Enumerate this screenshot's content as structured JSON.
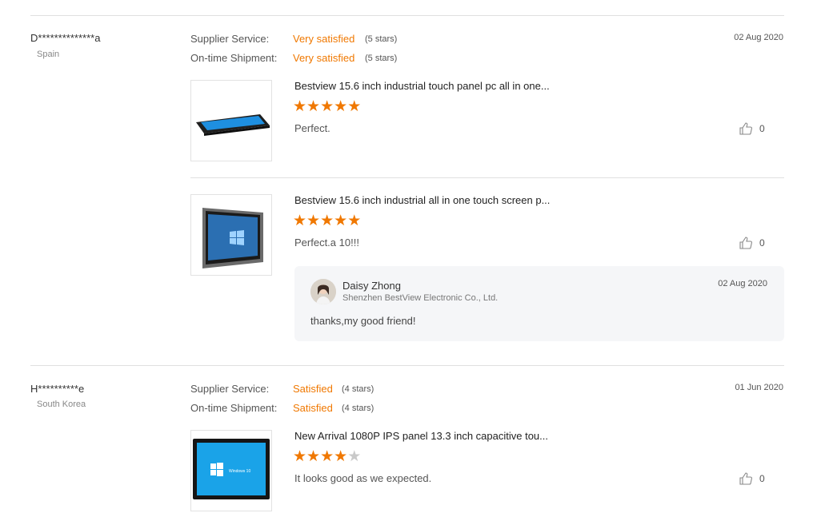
{
  "reviews": [
    {
      "buyer": "D**************a",
      "country": "Spain",
      "date": "02 Aug 2020",
      "supplier_service_label": "Supplier Service:",
      "supplier_service_rating": "Very satisfied",
      "supplier_service_stars": "(5 stars)",
      "shipment_label": "On-time Shipment:",
      "shipment_rating": "Very satisfied",
      "shipment_stars": "(5 stars)",
      "products": [
        {
          "title": "Bestview 15.6 inch industrial touch panel pc all in one...",
          "rating": 5,
          "comment": "Perfect.",
          "likes": "0",
          "image": "wide-panel-pc"
        },
        {
          "title": "Bestview 15.6 inch industrial all in one touch screen p...",
          "rating": 5,
          "comment": "Perfect.a 10!!!",
          "likes": "0",
          "image": "windows-touch-screen",
          "reply": {
            "name": "Daisy Zhong",
            "company": "Shenzhen BestView Electronic Co., Ltd.",
            "date": "02 Aug 2020",
            "text": "thanks,my good friend!"
          }
        }
      ]
    },
    {
      "buyer": "H**********e",
      "country": "South Korea",
      "date": "01 Jun 2020",
      "supplier_service_label": "Supplier Service:",
      "supplier_service_rating": "Satisfied",
      "supplier_service_stars": "(4 stars)",
      "shipment_label": "On-time Shipment:",
      "shipment_rating": "Satisfied",
      "shipment_stars": "(4 stars)",
      "products": [
        {
          "title": "New Arrival 1080P IPS panel 13.3 inch capacitive tou...",
          "rating": 4,
          "comment": "It looks good as we expected.",
          "likes": "0",
          "image": "windows-10-tablet",
          "image_text": "Windows 10"
        }
      ]
    }
  ],
  "colors": {
    "accent": "#f07800",
    "star_off": "#c9c9c9",
    "divider": "#e0e0e0",
    "reply_bg": "#f5f6f8"
  },
  "icons": {
    "like": "thumbs-up-icon",
    "star": "star-icon",
    "avatar": "avatar"
  }
}
